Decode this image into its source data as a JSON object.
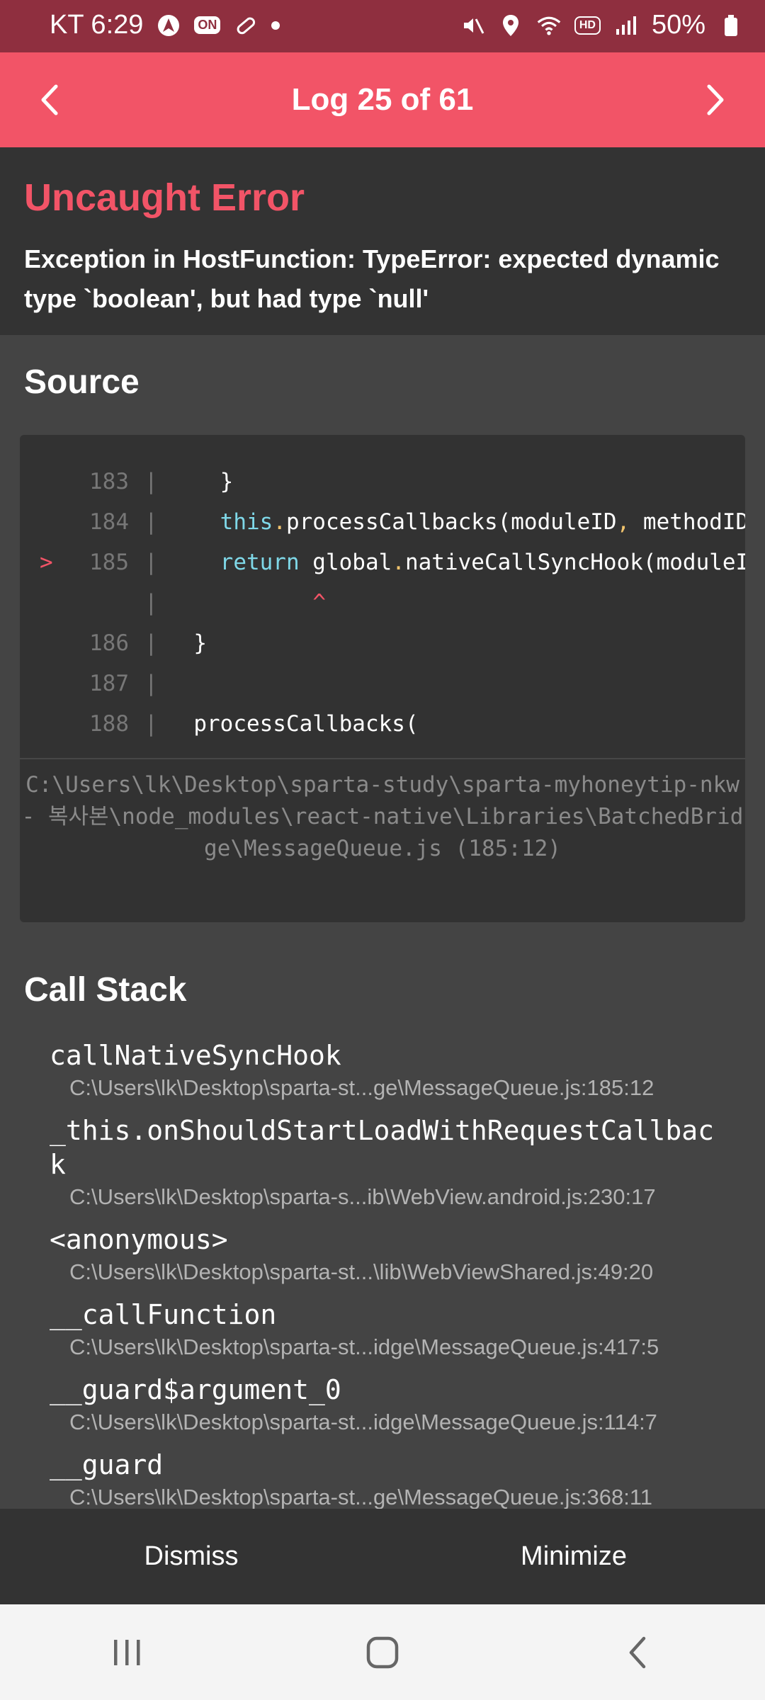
{
  "status_bar": {
    "carrier_time": "KT 6:29",
    "on_badge": "ON",
    "battery": "50%",
    "hd_badge": "HD"
  },
  "header": {
    "title": "Log 25 of 61"
  },
  "error": {
    "title": "Uncaught Error",
    "message": "Exception in HostFunction: TypeError: expected dynamic type `boolean', but had type `null'"
  },
  "source": {
    "title": "Source",
    "lines": [
      {
        "marker": "",
        "num": "183",
        "code": "    }"
      },
      {
        "marker": "",
        "num": "184",
        "code": "    this.processCallbacks(moduleID, methodID, params, onFail, onSucc"
      },
      {
        "marker": ">",
        "num": "185",
        "code": "    return global.nativeCallSyncHook(moduleID, methodID, params);"
      },
      {
        "marker": "",
        "num": "",
        "code": "           ^"
      },
      {
        "marker": "",
        "num": "186",
        "code": "  }"
      },
      {
        "marker": "",
        "num": "187",
        "code": ""
      },
      {
        "marker": "",
        "num": "188",
        "code": "  processCallbacks("
      }
    ],
    "file": "C:\\Users\\lk\\Desktop\\sparta-study\\sparta-myhoneytip-nkw - 복사본\\node_modules\\react-native\\Libraries\\BatchedBridge\\MessageQueue.js (185:12)"
  },
  "call_stack": {
    "title": "Call Stack",
    "frames": [
      {
        "fn": "callNativeSyncHook",
        "loc": "C:\\Users\\lk\\Desktop\\sparta-st...ge\\MessageQueue.js:185:12"
      },
      {
        "fn": "_this.onShouldStartLoadWithRequestCallback",
        "loc": "C:\\Users\\lk\\Desktop\\sparta-s...ib\\WebView.android.js:230:17"
      },
      {
        "fn": "<anonymous>",
        "loc": "C:\\Users\\lk\\Desktop\\sparta-st...\\lib\\WebViewShared.js:49:20"
      },
      {
        "fn": "__callFunction",
        "loc": "C:\\Users\\lk\\Desktop\\sparta-st...idge\\MessageQueue.js:417:5"
      },
      {
        "fn": "__guard$argument_0",
        "loc": "C:\\Users\\lk\\Desktop\\sparta-st...idge\\MessageQueue.js:114:7"
      },
      {
        "fn": "__guard",
        "loc": "C:\\Users\\lk\\Desktop\\sparta-st...ge\\MessageQueue.js:368:11"
      }
    ]
  },
  "actions": {
    "dismiss": "Dismiss",
    "minimize": "Minimize"
  }
}
